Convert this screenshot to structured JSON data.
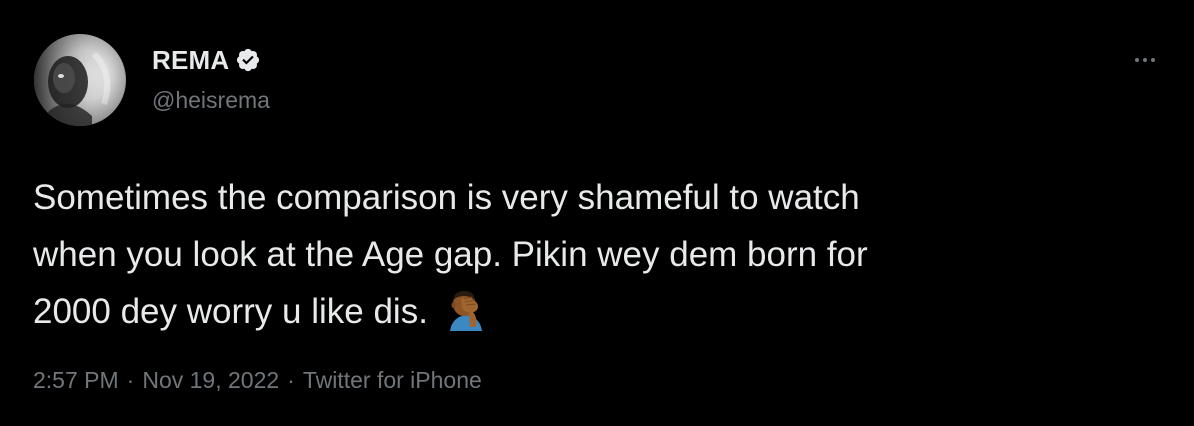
{
  "tweet": {
    "author": {
      "display_name": "REMA",
      "handle": "@heisrema",
      "verified": true,
      "avatar_icon": "profile-photo"
    },
    "text_lines": [
      "Sometimes the comparison is very shameful to watch",
      "when you look at the Age gap. Pikin wey dem born for",
      "2000 dey worry u like dis."
    ],
    "emoji": "man-facepalming-medium-dark-skin-tone",
    "time": "2:57 PM",
    "date": "Nov 19, 2022",
    "separator": "·",
    "source": "Twitter for iPhone",
    "more_icon": "ellipsis-icon"
  },
  "colors": {
    "background": "#000000",
    "primary_text": "#e7e9ea",
    "secondary_text": "#71767b",
    "verified_badge": "#e7e9ea"
  }
}
